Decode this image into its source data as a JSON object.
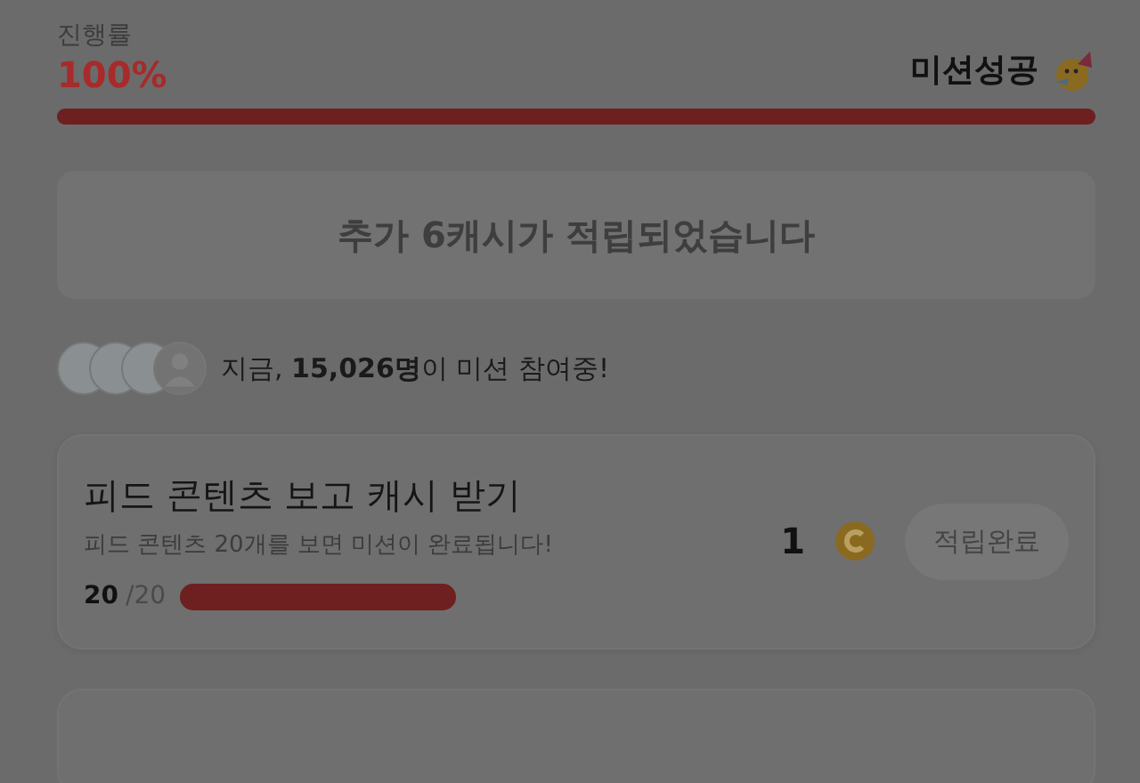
{
  "progress": {
    "label": "진행률",
    "value": "100%",
    "status": "미션성공",
    "level": 1
  },
  "banner": "추가 6캐시가 적립되었습니다",
  "participants": {
    "avatars": [
      {
        "kind": "photo"
      },
      {
        "kind": "photo"
      },
      {
        "kind": "photo"
      },
      {
        "kind": "silhouette"
      }
    ],
    "text": "지금, **15,026명**이 미션 참여중!"
  },
  "missions": [
    {
      "title": "피드 콘텐츠 보고 캐시 받기",
      "description": "피드 콘텐츠 20개를 보면 미션이 완료됩니다!",
      "count": "20",
      "total": "/20",
      "level": 1,
      "reward": "1",
      "button": "적립완료",
      "disabled": true
    }
  ]
}
